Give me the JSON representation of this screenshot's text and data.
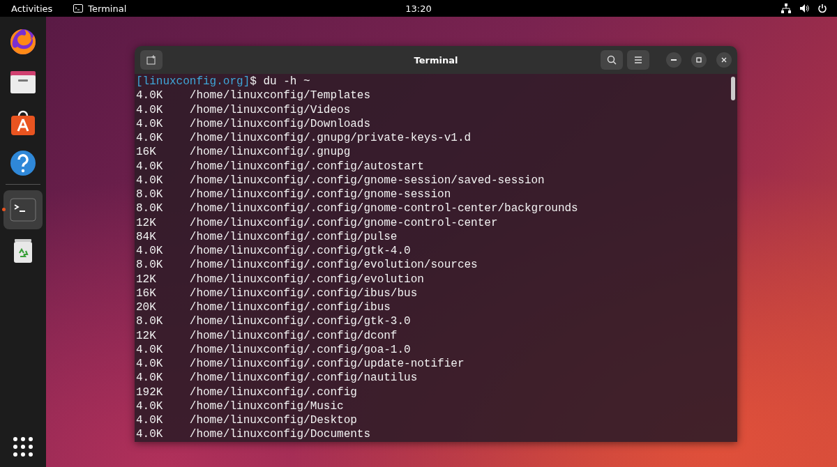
{
  "top_bar": {
    "activities": "Activities",
    "app_name": "Terminal",
    "clock": "13:20"
  },
  "dock": {
    "items": [
      {
        "kind": "browser",
        "selected": false,
        "running": false
      },
      {
        "kind": "files",
        "selected": false,
        "running": false
      },
      {
        "kind": "software",
        "selected": false,
        "running": false
      },
      {
        "kind": "help",
        "selected": false,
        "running": false
      },
      {
        "kind": "terminal",
        "selected": true,
        "running": true
      },
      {
        "kind": "trash",
        "selected": false,
        "running": false
      }
    ]
  },
  "terminal": {
    "title": "Terminal",
    "prompt": "[linuxconfig.org]",
    "command": "$ du -h ~",
    "lines": [
      {
        "size": "4.0K",
        "path": "/home/linuxconfig/Templates"
      },
      {
        "size": "4.0K",
        "path": "/home/linuxconfig/Videos"
      },
      {
        "size": "4.0K",
        "path": "/home/linuxconfig/Downloads"
      },
      {
        "size": "4.0K",
        "path": "/home/linuxconfig/.gnupg/private-keys-v1.d"
      },
      {
        "size": "16K",
        "path": "/home/linuxconfig/.gnupg"
      },
      {
        "size": "4.0K",
        "path": "/home/linuxconfig/.config/autostart"
      },
      {
        "size": "4.0K",
        "path": "/home/linuxconfig/.config/gnome-session/saved-session"
      },
      {
        "size": "8.0K",
        "path": "/home/linuxconfig/.config/gnome-session"
      },
      {
        "size": "8.0K",
        "path": "/home/linuxconfig/.config/gnome-control-center/backgrounds"
      },
      {
        "size": "12K",
        "path": "/home/linuxconfig/.config/gnome-control-center"
      },
      {
        "size": "84K",
        "path": "/home/linuxconfig/.config/pulse"
      },
      {
        "size": "4.0K",
        "path": "/home/linuxconfig/.config/gtk-4.0"
      },
      {
        "size": "8.0K",
        "path": "/home/linuxconfig/.config/evolution/sources"
      },
      {
        "size": "12K",
        "path": "/home/linuxconfig/.config/evolution"
      },
      {
        "size": "16K",
        "path": "/home/linuxconfig/.config/ibus/bus"
      },
      {
        "size": "20K",
        "path": "/home/linuxconfig/.config/ibus"
      },
      {
        "size": "8.0K",
        "path": "/home/linuxconfig/.config/gtk-3.0"
      },
      {
        "size": "12K",
        "path": "/home/linuxconfig/.config/dconf"
      },
      {
        "size": "4.0K",
        "path": "/home/linuxconfig/.config/goa-1.0"
      },
      {
        "size": "4.0K",
        "path": "/home/linuxconfig/.config/update-notifier"
      },
      {
        "size": "4.0K",
        "path": "/home/linuxconfig/.config/nautilus"
      },
      {
        "size": "192K",
        "path": "/home/linuxconfig/.config"
      },
      {
        "size": "4.0K",
        "path": "/home/linuxconfig/Music"
      },
      {
        "size": "4.0K",
        "path": "/home/linuxconfig/Desktop"
      },
      {
        "size": "4.0K",
        "path": "/home/linuxconfig/Documents"
      }
    ]
  }
}
